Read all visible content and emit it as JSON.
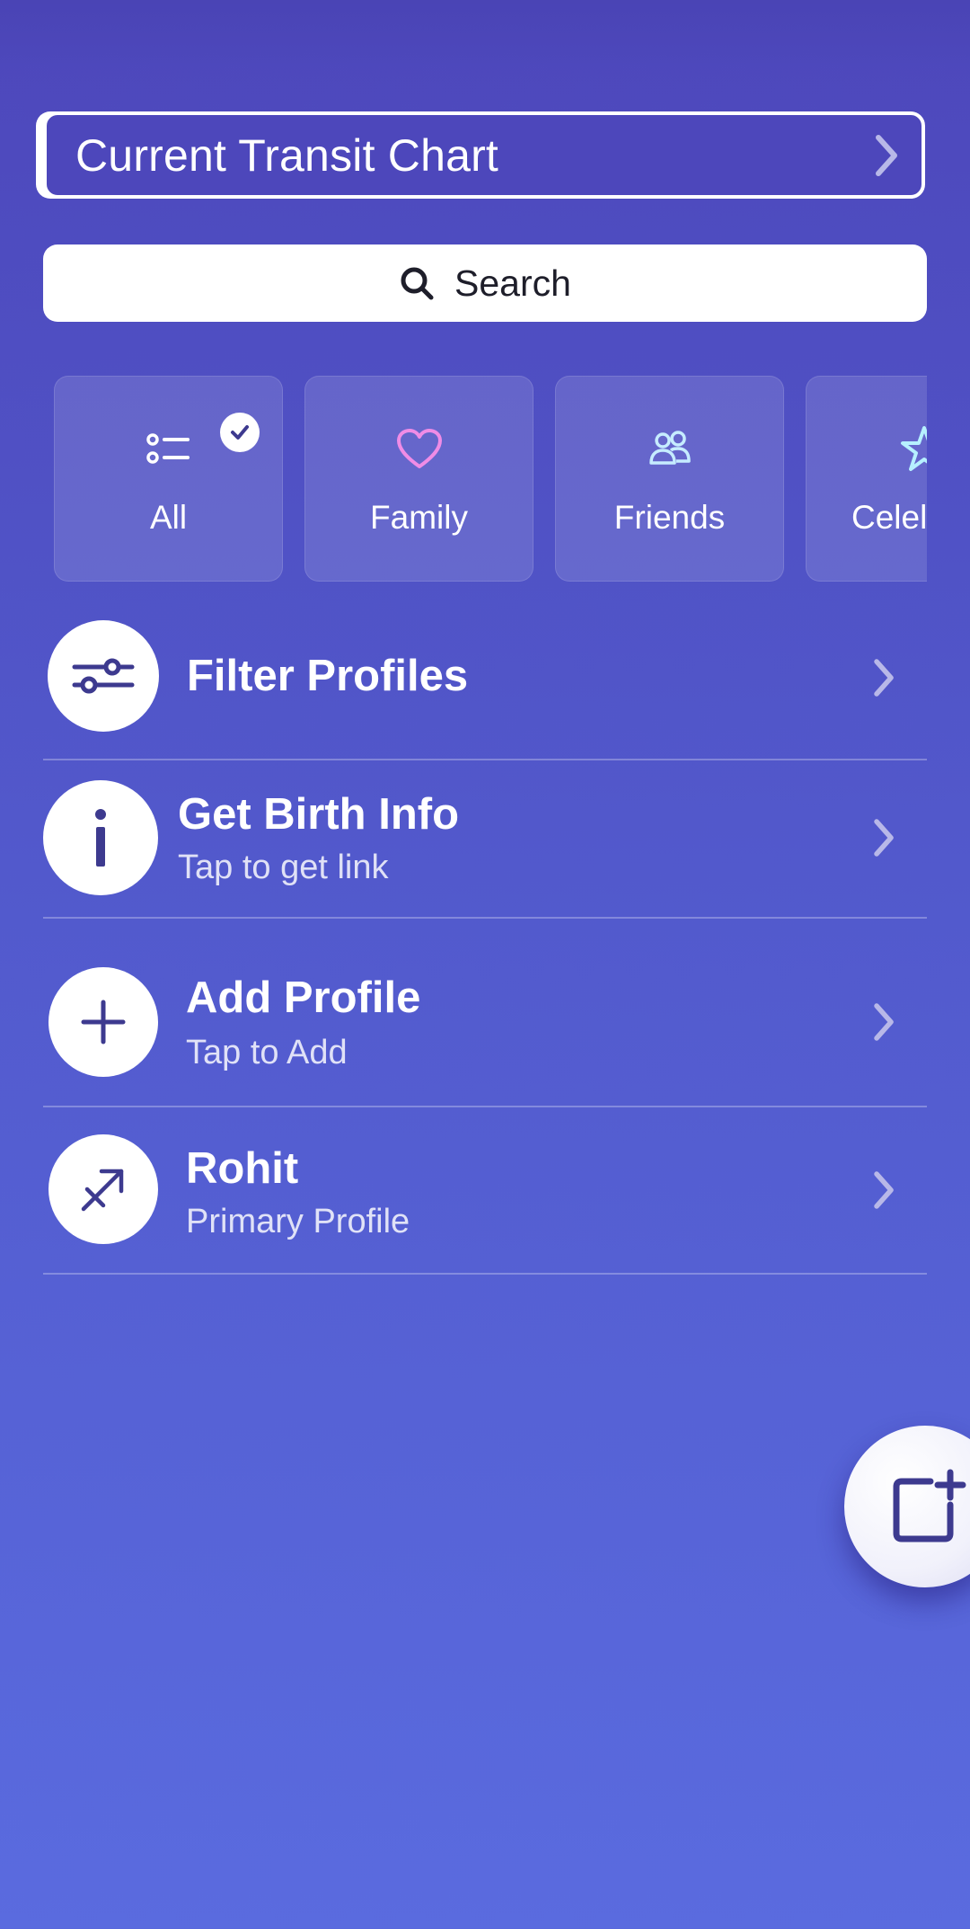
{
  "header": {
    "transit_chart_label": "Current Transit Chart"
  },
  "search": {
    "label": "Search"
  },
  "categories": [
    {
      "label": "All",
      "icon": "list-icon",
      "selected": true
    },
    {
      "label": "Family",
      "icon": "heart-icon",
      "selected": false
    },
    {
      "label": "Friends",
      "icon": "people-icon",
      "selected": false
    },
    {
      "label": "Celel",
      "icon": "star-icon",
      "selected": false
    }
  ],
  "rows": {
    "filter": {
      "title": "Filter Profiles",
      "icon": "sliders-icon"
    },
    "birth_info": {
      "title": "Get Birth Info",
      "subtitle": "Tap to get link",
      "icon": "info-icon"
    },
    "add_profile": {
      "title": "Add Profile",
      "subtitle": "Tap to Add",
      "icon": "plus-icon"
    },
    "rohit": {
      "title": "Rohit",
      "subtitle": "Primary Profile",
      "icon": "sagittarius-icon"
    }
  },
  "fab": {
    "icon": "new-chart-icon"
  },
  "colors": {
    "background_top": "#4d47bb",
    "background_bottom": "#5a6bdf",
    "icon_accent": "#3d3a8f",
    "heart": "#f08ce6",
    "friends_icon": "#c6ecff",
    "star_icon": "#b6f0ff"
  }
}
